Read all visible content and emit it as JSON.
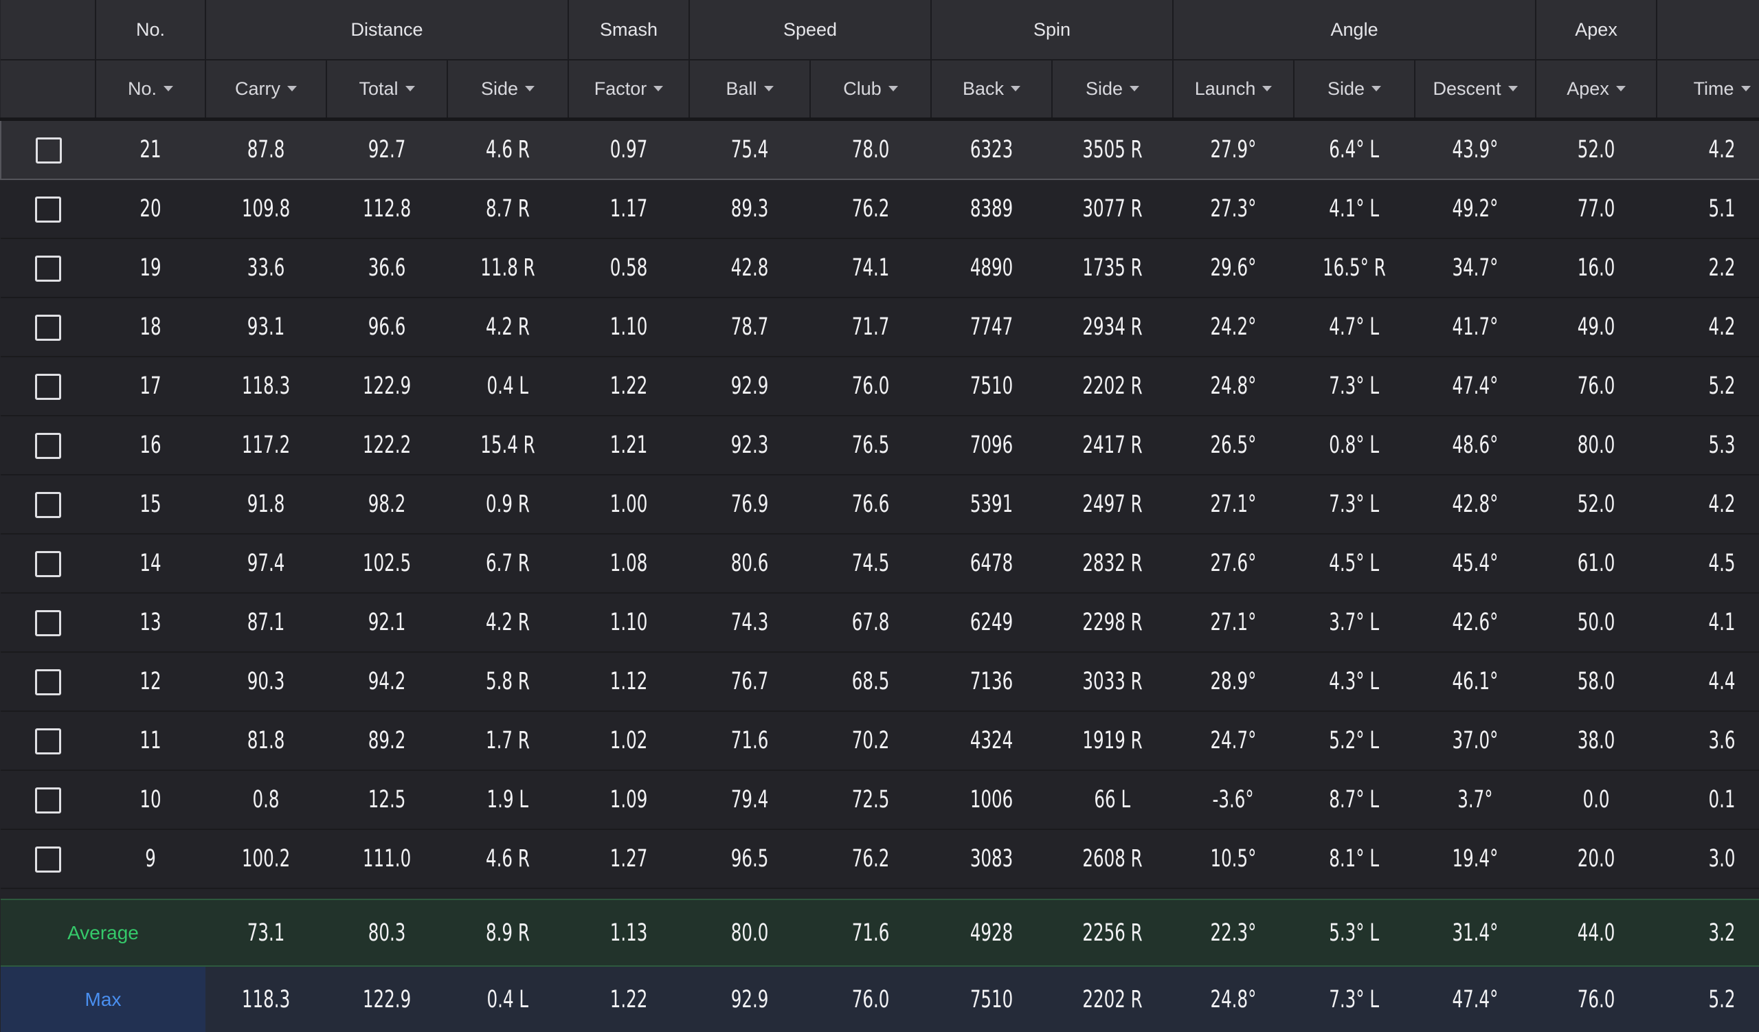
{
  "header": {
    "groups": [
      "No.",
      "Distance",
      "Smash",
      "Speed",
      "Spin",
      "Angle",
      "Apex",
      ""
    ],
    "columns": [
      "No.",
      "Carry",
      "Total",
      "Side",
      "Factor",
      "Ball",
      "Club",
      "Back",
      "Side",
      "Launch",
      "Side",
      "Descent",
      "Apex",
      "Time"
    ]
  },
  "rows": [
    {
      "no": "21",
      "carry": "87.8",
      "total": "92.7",
      "side": "4.6 R",
      "smash": "0.97",
      "ball": "75.4",
      "club": "78.0",
      "back": "6323",
      "spin_side": "3505 R",
      "launch": "27.9°",
      "angle_side": "6.4° L",
      "descent": "43.9°",
      "apex": "52.0",
      "time": "4.2"
    },
    {
      "no": "20",
      "carry": "109.8",
      "total": "112.8",
      "side": "8.7 R",
      "smash": "1.17",
      "ball": "89.3",
      "club": "76.2",
      "back": "8389",
      "spin_side": "3077 R",
      "launch": "27.3°",
      "angle_side": "4.1° L",
      "descent": "49.2°",
      "apex": "77.0",
      "time": "5.1"
    },
    {
      "no": "19",
      "carry": "33.6",
      "total": "36.6",
      "side": "11.8 R",
      "smash": "0.58",
      "ball": "42.8",
      "club": "74.1",
      "back": "4890",
      "spin_side": "1735 R",
      "launch": "29.6°",
      "angle_side": "16.5° R",
      "descent": "34.7°",
      "apex": "16.0",
      "time": "2.2"
    },
    {
      "no": "18",
      "carry": "93.1",
      "total": "96.6",
      "side": "4.2 R",
      "smash": "1.10",
      "ball": "78.7",
      "club": "71.7",
      "back": "7747",
      "spin_side": "2934 R",
      "launch": "24.2°",
      "angle_side": "4.7° L",
      "descent": "41.7°",
      "apex": "49.0",
      "time": "4.2"
    },
    {
      "no": "17",
      "carry": "118.3",
      "total": "122.9",
      "side": "0.4 L",
      "smash": "1.22",
      "ball": "92.9",
      "club": "76.0",
      "back": "7510",
      "spin_side": "2202 R",
      "launch": "24.8°",
      "angle_side": "7.3° L",
      "descent": "47.4°",
      "apex": "76.0",
      "time": "5.2"
    },
    {
      "no": "16",
      "carry": "117.2",
      "total": "122.2",
      "side": "15.4 R",
      "smash": "1.21",
      "ball": "92.3",
      "club": "76.5",
      "back": "7096",
      "spin_side": "2417 R",
      "launch": "26.5°",
      "angle_side": "0.8° L",
      "descent": "48.6°",
      "apex": "80.0",
      "time": "5.3"
    },
    {
      "no": "15",
      "carry": "91.8",
      "total": "98.2",
      "side": "0.9 R",
      "smash": "1.00",
      "ball": "76.9",
      "club": "76.6",
      "back": "5391",
      "spin_side": "2497 R",
      "launch": "27.1°",
      "angle_side": "7.3° L",
      "descent": "42.8°",
      "apex": "52.0",
      "time": "4.2"
    },
    {
      "no": "14",
      "carry": "97.4",
      "total": "102.5",
      "side": "6.7 R",
      "smash": "1.08",
      "ball": "80.6",
      "club": "74.5",
      "back": "6478",
      "spin_side": "2832 R",
      "launch": "27.6°",
      "angle_side": "4.5° L",
      "descent": "45.4°",
      "apex": "61.0",
      "time": "4.5"
    },
    {
      "no": "13",
      "carry": "87.1",
      "total": "92.1",
      "side": "4.2 R",
      "smash": "1.10",
      "ball": "74.3",
      "club": "67.8",
      "back": "6249",
      "spin_side": "2298 R",
      "launch": "27.1°",
      "angle_side": "3.7° L",
      "descent": "42.6°",
      "apex": "50.0",
      "time": "4.1"
    },
    {
      "no": "12",
      "carry": "90.3",
      "total": "94.2",
      "side": "5.8 R",
      "smash": "1.12",
      "ball": "76.7",
      "club": "68.5",
      "back": "7136",
      "spin_side": "3033 R",
      "launch": "28.9°",
      "angle_side": "4.3° L",
      "descent": "46.1°",
      "apex": "58.0",
      "time": "4.4"
    },
    {
      "no": "11",
      "carry": "81.8",
      "total": "89.2",
      "side": "1.7 R",
      "smash": "1.02",
      "ball": "71.6",
      "club": "70.2",
      "back": "4324",
      "spin_side": "1919 R",
      "launch": "24.7°",
      "angle_side": "5.2° L",
      "descent": "37.0°",
      "apex": "38.0",
      "time": "3.6"
    },
    {
      "no": "10",
      "carry": "0.8",
      "total": "12.5",
      "side": "1.9 L",
      "smash": "1.09",
      "ball": "79.4",
      "club": "72.5",
      "back": "1006",
      "spin_side": "66 L",
      "launch": "-3.6°",
      "angle_side": "8.7° L",
      "descent": "3.7°",
      "apex": "0.0",
      "time": "0.1"
    },
    {
      "no": "9",
      "carry": "100.2",
      "total": "111.0",
      "side": "4.6 R",
      "smash": "1.27",
      "ball": "96.5",
      "club": "76.2",
      "back": "3083",
      "spin_side": "2608 R",
      "launch": "10.5°",
      "angle_side": "8.1° L",
      "descent": "19.4°",
      "apex": "20.0",
      "time": "3.0"
    }
  ],
  "summary": {
    "average": {
      "label": "Average",
      "carry": "73.1",
      "total": "80.3",
      "side": "8.9 R",
      "smash": "1.13",
      "ball": "80.0",
      "club": "71.6",
      "back": "4928",
      "spin_side": "2256 R",
      "launch": "22.3°",
      "angle_side": "5.3° L",
      "descent": "31.4°",
      "apex": "44.0",
      "time": "3.2"
    },
    "max": {
      "label": "Max",
      "carry": "118.3",
      "total": "122.9",
      "side": "0.4 L",
      "smash": "1.22",
      "ball": "92.9",
      "club": "76.0",
      "back": "7510",
      "spin_side": "2202 R",
      "launch": "24.8°",
      "angle_side": "7.3° L",
      "descent": "47.4°",
      "apex": "76.0",
      "time": "5.2"
    }
  },
  "colors": {
    "background": "#232328",
    "header_bg": "#2e2e33",
    "average_label": "#35c96a",
    "max_label": "#4a8ff0"
  },
  "icons": {
    "sort": "caret-down-icon",
    "row_select": "checkbox-icon"
  }
}
